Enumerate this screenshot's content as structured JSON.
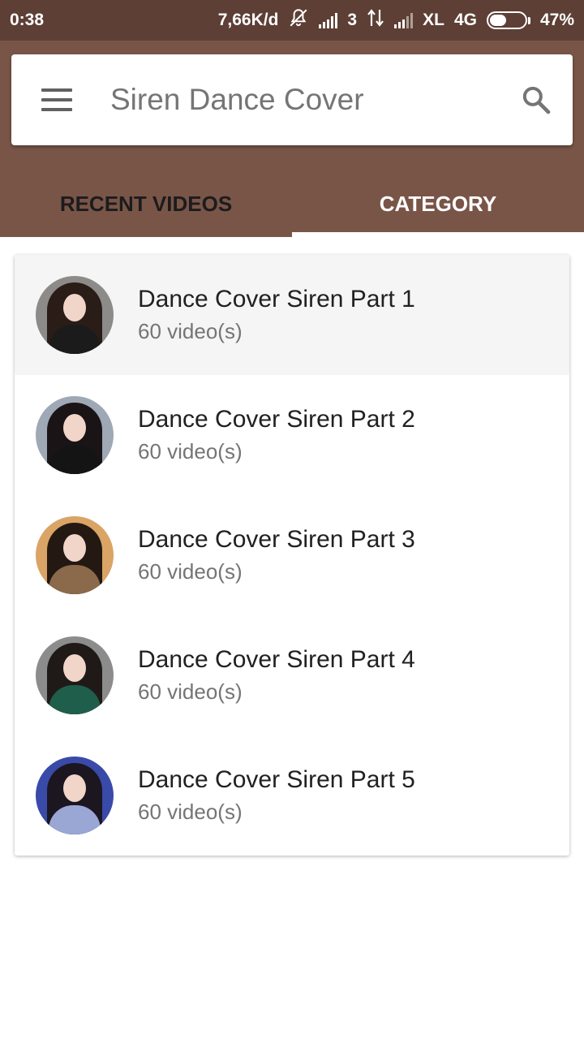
{
  "status_bar": {
    "time": "0:38",
    "speed": "7,66K/d",
    "sim_number": "3",
    "carrier": "XL",
    "network": "4G",
    "battery": "47%",
    "battery_level": 0.47,
    "icons": [
      "notifications-off-icon",
      "signal-icon",
      "data-transfer-icon",
      "signal-icon",
      "battery-icon"
    ]
  },
  "header": {
    "title": "Siren Dance Cover",
    "menu_icon": "menu-icon",
    "search_icon": "search-icon",
    "colors": {
      "status_bar": "#5d3f35",
      "app_bar": "#795548"
    }
  },
  "tabs": [
    {
      "label": "RECENT VIDEOS",
      "active": false
    },
    {
      "label": "CATEGORY",
      "active": true
    }
  ],
  "categories": [
    {
      "title": "Dance Cover Siren Part 1",
      "count": "60 video(s)"
    },
    {
      "title": "Dance Cover Siren Part 2",
      "count": "60 video(s)"
    },
    {
      "title": "Dance Cover Siren Part 3",
      "count": "60 video(s)"
    },
    {
      "title": "Dance Cover Siren Part 4",
      "count": "60 video(s)"
    },
    {
      "title": "Dance Cover Siren Part 5",
      "count": "60 video(s)"
    }
  ]
}
